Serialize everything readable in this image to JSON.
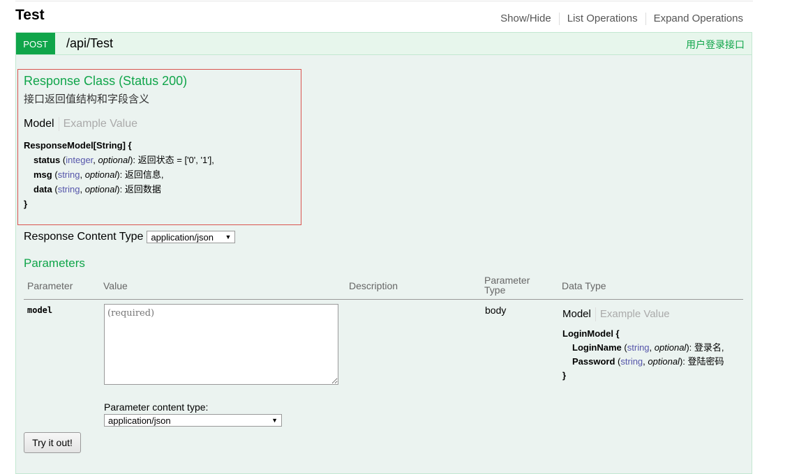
{
  "resource": {
    "title": "Test",
    "links": [
      "Show/Hide",
      "List Operations",
      "Expand Operations"
    ]
  },
  "operation": {
    "method": "POST",
    "path": "/api/Test",
    "summary": "用户登录接口",
    "method_color": "#10a54a"
  },
  "response_class": {
    "title": "Response Class (Status 200)",
    "description": "接口返回值结构和字段含义",
    "tabs": [
      "Model",
      "Example Value"
    ],
    "model_open": "ResponseModel[String] {",
    "fields": [
      {
        "name": "status",
        "type": "integer",
        "optional": "optional",
        "desc": ": 返回状态 = ['0', '1'],"
      },
      {
        "name": "msg",
        "type": "string",
        "optional": "optional",
        "desc": ": 返回信息,"
      },
      {
        "name": "data",
        "type": "string",
        "optional": "optional",
        "desc": ": 返回数据"
      }
    ],
    "model_close": "}"
  },
  "response_content_type": {
    "label": "Response Content Type",
    "value": "application/json"
  },
  "parameters": {
    "title": "Parameters",
    "headers": [
      "Parameter",
      "Value",
      "Description",
      "Parameter Type",
      "Data Type"
    ],
    "rows": [
      {
        "name": "model",
        "placeholder": "(required)",
        "description": "",
        "param_type": "body",
        "data_type_tabs": [
          "Model",
          "Example Value"
        ],
        "model_open": "LoginModel {",
        "fields": [
          {
            "name": "LoginName",
            "type": "string",
            "optional": "optional",
            "desc": ": 登录名,"
          },
          {
            "name": "Password",
            "type": "string",
            "optional": "optional",
            "desc": ": 登陆密码"
          }
        ],
        "model_close": "}"
      }
    ],
    "content_type_label": "Parameter content type:",
    "content_type_value": "application/json"
  },
  "try_button": "Try it out!",
  "colors": {
    "accent": "#10a54a",
    "highlight_border": "#d9534f"
  }
}
